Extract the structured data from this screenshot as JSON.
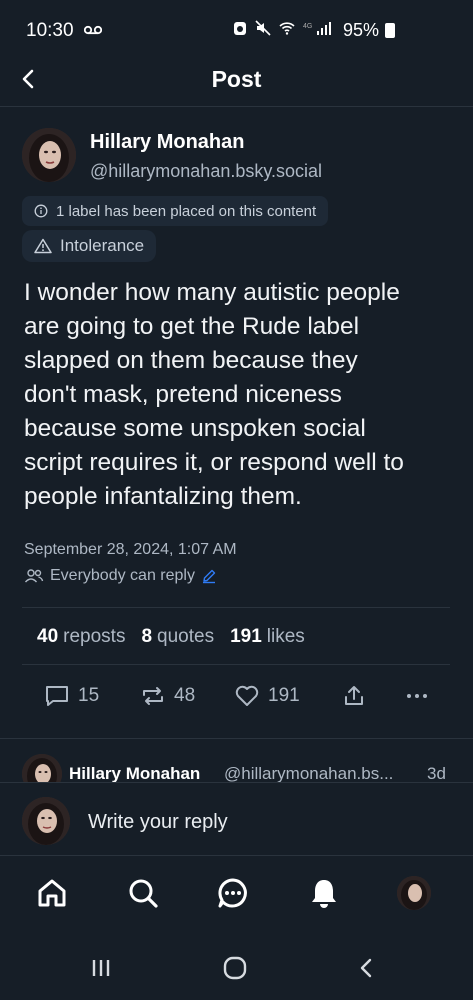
{
  "status_bar": {
    "time": "10:30",
    "battery": "95%"
  },
  "header": {
    "title": "Post"
  },
  "post": {
    "author_name": "Hillary Monahan",
    "author_handle": "@hillarymonahan.bsky.social",
    "label_notice": "1 label has been placed on this content",
    "label": "Intolerance",
    "text": "I wonder how many autistic people\nare going to get the Rude label\nslapped on them because they\ndon't mask, pretend niceness\nbecause some unspoken social\nscript requires it, or respond well to\npeople infantalizing them.",
    "date": "September 28, 2024, 1:07 AM",
    "reply_setting": "Everybody can reply"
  },
  "stats": {
    "reposts_count": "40",
    "reposts_label": "reposts",
    "quotes_count": "8",
    "quotes_label": "quotes",
    "likes_count": "191",
    "likes_label": "likes"
  },
  "actions": {
    "replies": "15",
    "reposts": "48",
    "likes": "191"
  },
  "reply_preview": {
    "author_name": "Hillary Monahan",
    "author_handle": "@hillarymonahan.bs...",
    "time": "3d"
  },
  "composer": {
    "placeholder": "Write your reply"
  },
  "tabbar": {
    "items": [
      "home-icon",
      "search-icon",
      "chat-icon",
      "notifications-icon",
      "profile-avatar"
    ]
  },
  "colors": {
    "background": "#161e27",
    "text": "#f1f3f5",
    "muted": "#aeb8c4",
    "accent": "#2f7cf6",
    "chip": "#1e2936"
  }
}
